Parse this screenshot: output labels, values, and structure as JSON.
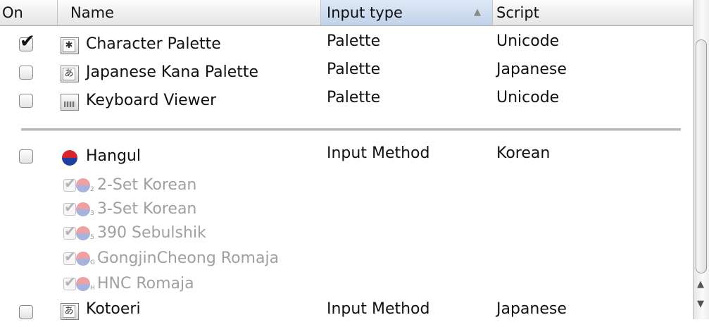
{
  "columns": {
    "on": "On",
    "name": "Name",
    "input_type": "Input type",
    "script": "Script"
  },
  "rows": [
    {
      "checked": true,
      "icon": "character-palette-icon",
      "name": "Character Palette",
      "input_type": "Palette",
      "script": "Unicode"
    },
    {
      "checked": false,
      "icon": "japanese-kana-palette-icon",
      "name": "Japanese Kana Palette",
      "input_type": "Palette",
      "script": "Japanese"
    },
    {
      "checked": false,
      "icon": "keyboard-viewer-icon",
      "name": "Keyboard Viewer",
      "input_type": "Palette",
      "script": "Unicode"
    },
    {
      "checked": false,
      "icon": "korean-flag-icon",
      "name": "Hangul",
      "input_type": "Input Method",
      "script": "Korean"
    },
    {
      "checked": false,
      "icon": "kotoeri-icon",
      "name": "Kotoeri",
      "input_type": "Input Method",
      "script": "Japanese"
    }
  ],
  "hangul_subitems": [
    {
      "badge": "2",
      "name": "2-Set Korean"
    },
    {
      "badge": "3",
      "name": "3-Set Korean"
    },
    {
      "badge": "5",
      "name": "390 Sebulshik"
    },
    {
      "badge": "G",
      "name": "GongjinCheong Romaja"
    },
    {
      "badge": "H",
      "name": "HNC Romaja"
    }
  ],
  "icon_glyphs": {
    "character_palette": "✱",
    "kana": "あ"
  },
  "scroll_arrows": {
    "up": "▲",
    "down": "▼"
  },
  "sort_arrow": "▲",
  "check_glyph": "✔"
}
